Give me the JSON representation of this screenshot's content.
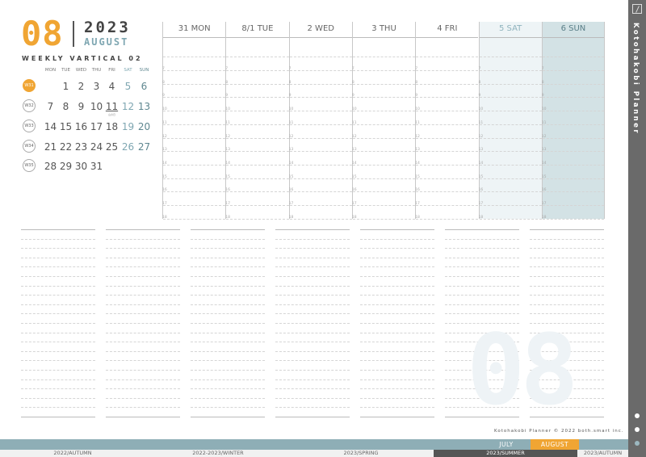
{
  "header": {
    "month_number": "08",
    "year": "2023",
    "month_name": "AUGUST",
    "subtitle": "WEEKLY VARTICAL 02"
  },
  "mini_calendar": {
    "weekdays": [
      "MON",
      "TUE",
      "WED",
      "THU",
      "FRI",
      "SAT",
      "SUN"
    ],
    "weeks": [
      {
        "label": "W31",
        "current": true,
        "days": [
          "",
          "1",
          "2",
          "3",
          "4",
          "5",
          "6"
        ]
      },
      {
        "label": "W32",
        "current": false,
        "days": [
          "7",
          "8",
          "9",
          "10",
          "11",
          "12",
          "13"
        ]
      },
      {
        "label": "W33",
        "current": false,
        "days": [
          "14",
          "15",
          "16",
          "17",
          "18",
          "19",
          "20"
        ]
      },
      {
        "label": "W34",
        "current": false,
        "days": [
          "21",
          "22",
          "23",
          "24",
          "25",
          "26",
          "27"
        ]
      },
      {
        "label": "W35",
        "current": false,
        "days": [
          "28",
          "29",
          "30",
          "31",
          "",
          "",
          ""
        ]
      }
    ],
    "holiday_note": "山の日"
  },
  "week_columns": [
    "31 MON",
    "8/1 TUE",
    "2 WED",
    "3 THU",
    "4 FRI",
    "5 SAT",
    "6 SUN"
  ],
  "hours": [
    "7",
    "8",
    "9",
    "10",
    "11",
    "12",
    "13",
    "14",
    "15",
    "16",
    "17",
    "18"
  ],
  "watermark_number": "08",
  "copyright": "Kotohakobi Planner © 2022 both.smart inc.",
  "month_tabs": [
    "JULY",
    "AUGUST"
  ],
  "active_month": "AUGUST",
  "season_tabs": [
    "2022/AUTUMN",
    "2022-2023/WINTER",
    "2023/SPRING",
    "2023/SUMMER",
    "2023/AUTUMN"
  ],
  "active_season": "2023/SUMMER",
  "sidebar": {
    "brand": "Kotohakobi Planner",
    "icon": "pen-icon"
  },
  "colors": {
    "accent": "#f0a533",
    "teal": "#8eaeb6",
    "saturday_bg": "#eef4f6",
    "sunday_bg": "#d3e2e5",
    "sidebar": "#6a6a6a"
  }
}
